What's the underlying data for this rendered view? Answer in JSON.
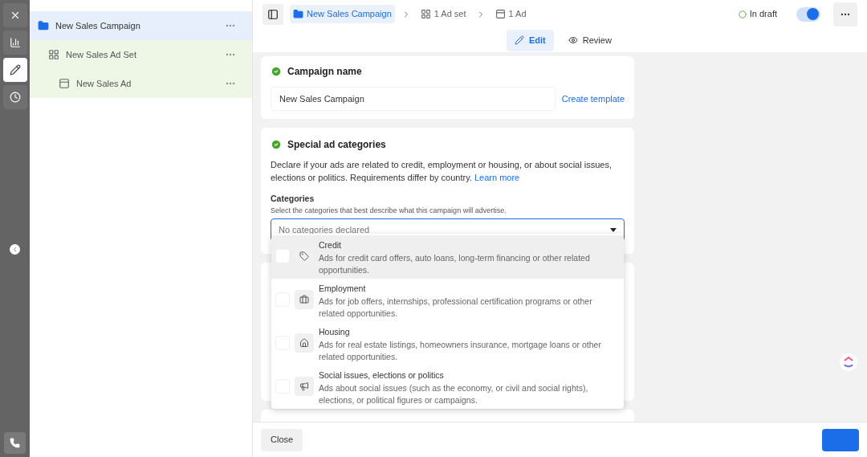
{
  "tools": [
    {
      "kind": "close",
      "selected": false
    },
    {
      "kind": "chart",
      "selected": false
    },
    {
      "kind": "edit",
      "selected": true
    },
    {
      "kind": "history",
      "selected": false
    }
  ],
  "tree": [
    {
      "kind": "campaign",
      "label": "New Sales Campaign",
      "selected": true,
      "children": [
        {
          "kind": "adset",
          "label": "New Sales Ad Set",
          "selected": false,
          "children": [
            {
              "kind": "ad",
              "label": "New Sales Ad",
              "selected": false
            }
          ]
        }
      ]
    }
  ],
  "breadcrumb": [
    {
      "kind": "campaign",
      "label": "New Sales Campaign",
      "selected": true
    },
    {
      "kind": "adset",
      "label": "1 Ad set",
      "selected": false
    },
    {
      "kind": "ad",
      "label": "1 Ad",
      "selected": false
    }
  ],
  "status": {
    "label": "In draft",
    "on": true
  },
  "tabs": [
    {
      "kind": "edit",
      "label": "Edit",
      "selected": true
    },
    {
      "kind": "review",
      "label": "Review",
      "selected": false
    }
  ],
  "campaign_name": {
    "title": "Campaign name",
    "complete": true,
    "value": "New Sales Campaign",
    "link": "Create template"
  },
  "special_ad_categories": {
    "title": "Special ad categories",
    "complete": true,
    "description": "Declare if your ads are related to credit, employment or housing, or about social issues, elections or politics. Requirements differ by country.",
    "link": "Learn more",
    "field_label": "Categories",
    "field_hint": "Select the categories that best describe what this campaign will advertise.",
    "placeholder": "No categories declared",
    "expanded": true,
    "options": [
      {
        "kind": "credit",
        "label": "Credit",
        "description": "Ads for credit card offers, auto loans, long-term financing or other related opportunities.",
        "checked": false,
        "selected": true
      },
      {
        "kind": "employment",
        "label": "Employment",
        "description": "Ads for job offers, internships, professional certification programs or other related opportunities.",
        "checked": false,
        "selected": false
      },
      {
        "kind": "housing",
        "label": "Housing",
        "description": "Ads for real estate listings, homeowners insurance, mortgage loans or other related opportunities.",
        "checked": false,
        "selected": false
      },
      {
        "kind": "social",
        "label": "Social issues, elections or politics",
        "description": "Ads about social issues (such as the economy, or civil and social rights), elections, or political figures or campaigns.",
        "checked": false,
        "selected": false
      }
    ]
  },
  "footer": {
    "close": "Close"
  }
}
